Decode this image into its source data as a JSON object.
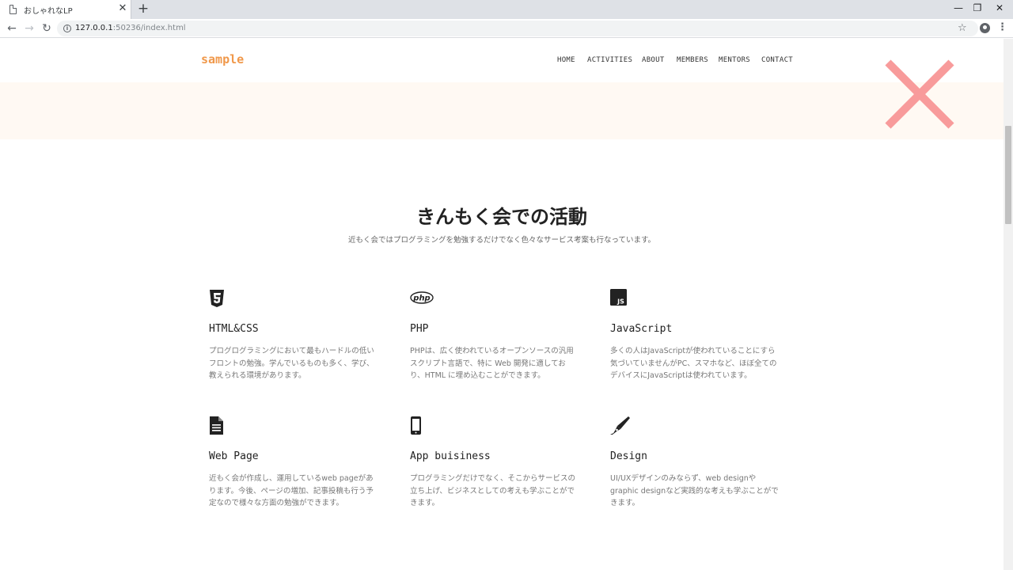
{
  "browser": {
    "tab_title": "おしゃれなLP",
    "tab_close": "✕",
    "new_tab": "+",
    "win_min": "—",
    "win_max": "❐",
    "win_close": "✕",
    "back": "←",
    "forward": "→",
    "reload": "↻",
    "url_host": "127.0.0.1",
    "url_path": ":50236/index.html",
    "star": "☆",
    "menu": "⋮"
  },
  "header": {
    "logo": "sample",
    "nav": [
      "HOME",
      "ACTIVITIES",
      "ABOUT",
      "MEMBERS",
      "MENTORS",
      "CONTACT"
    ]
  },
  "section": {
    "title": "きんもく会での活動",
    "subtitle": "近もく会ではプログラミングを勉強するだけでなく色々なサービス考案も行なっています。"
  },
  "cards": [
    {
      "icon": "html5-icon",
      "title": "HTML&CSS",
      "text": "プログログラミングにおいて最もハードルの低いフロントの勉強。学んでいるものも多く、学び、教えられる環境があります。"
    },
    {
      "icon": "php-icon",
      "title": "PHP",
      "text": "PHPは、広く使われているオープンソースの汎用スクリプト言語で、特に Web 開発に適しており、HTML に埋め込むことができます。"
    },
    {
      "icon": "js-icon",
      "title": "JavaScript",
      "text": "多くの人はJavaScriptが使われていることにすら気づいていませんがPC、スマホなど、ほぼ全てのデバイスにJavaScriptは使われています。"
    },
    {
      "icon": "document-icon",
      "title": "Web Page",
      "text": "近もく会が作成し、運用しているweb pageがあります。今後、ページの増加、記事投稿も行う予定なので様々な方面の勉強ができます。"
    },
    {
      "icon": "mobile-icon",
      "title": "App buisiness",
      "text": "プログラミングだけでなく、そこからサービスの立ち上げ、ビジネスとしての考えも学ぶことができます。"
    },
    {
      "icon": "pen-icon",
      "title": "Design",
      "text": "UI/UXデザインのみならず、web designやgraphic designなど実践的な考えも学ぶことができます。"
    }
  ],
  "colors": {
    "accent": "#f0984a",
    "hero_band": "#fff9f3",
    "close_x": "#f89b9b"
  }
}
